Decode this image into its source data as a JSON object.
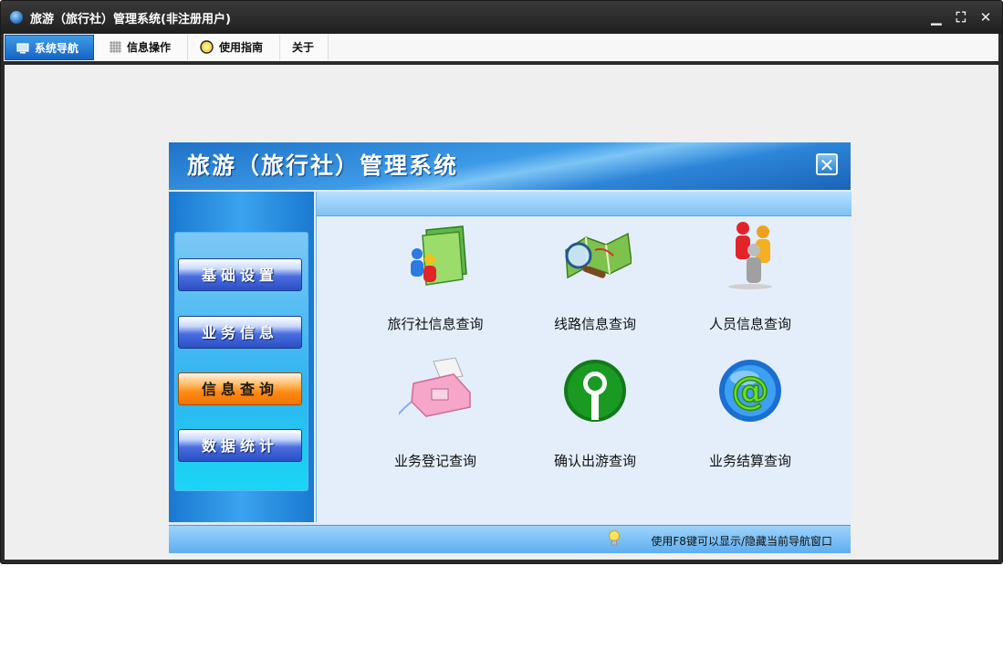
{
  "window": {
    "title": "旅游（旅行社）管理系统(非注册用户)",
    "controls": {
      "minimize": "▁",
      "restore": "⛶",
      "close": "✕"
    }
  },
  "menu": {
    "tabs": [
      {
        "label": "系统导航",
        "icon": "monitor-icon"
      },
      {
        "label": "信息操作",
        "icon": "grid-icon"
      },
      {
        "label": "使用指南",
        "icon": "help-icon"
      },
      {
        "label": "关于",
        "icon": ""
      }
    ]
  },
  "panel": {
    "title": "旅游（旅行社）管理系统",
    "close": "✕",
    "sidebar": [
      {
        "label": "基础设置"
      },
      {
        "label": "业务信息"
      },
      {
        "label": "信息查询",
        "active": true
      },
      {
        "label": "数据统计"
      }
    ],
    "tiles": [
      {
        "label": "旅行社信息查询",
        "icon": "folder-people-icon"
      },
      {
        "label": "线路信息查询",
        "icon": "map-magnifier-icon"
      },
      {
        "label": "人员信息查询",
        "icon": "people-icon"
      },
      {
        "label": "业务登记查询",
        "icon": "fax-icon"
      },
      {
        "label": "确认出游查询",
        "icon": "keyhole-icon"
      },
      {
        "label": "业务结算查询",
        "icon": "at-sign-icon"
      }
    ],
    "status": "使用F8键可以显示/隐藏当前导航窗口"
  },
  "colors": {
    "accent_blue": "#1565c4",
    "active_orange": "#ff8a16"
  }
}
